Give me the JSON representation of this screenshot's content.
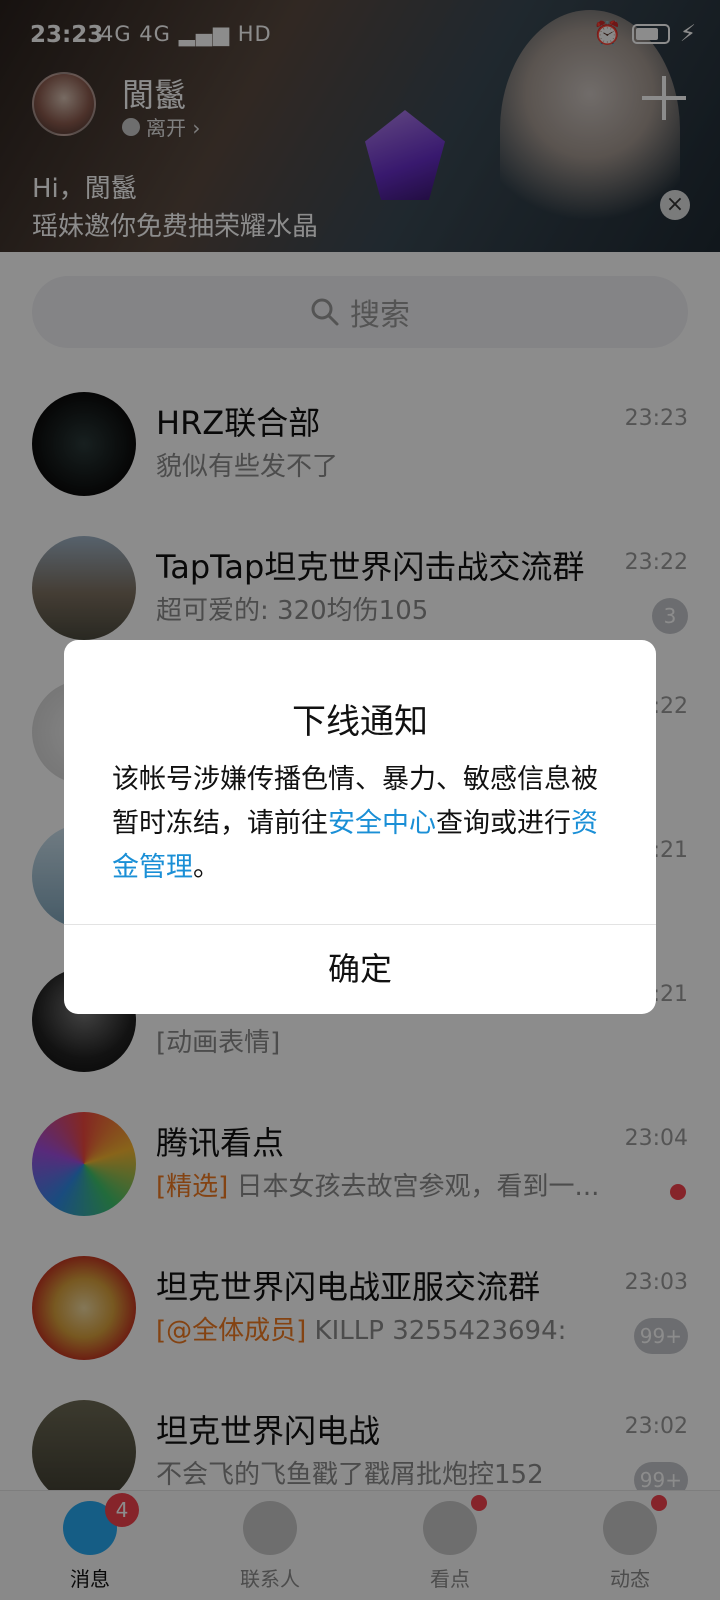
{
  "status_bar": {
    "time": "23:23",
    "signal": "4G 4G",
    "hd": "HD"
  },
  "header": {
    "nickname": "閬鬣",
    "presence": "离开 ›",
    "promo_greeting": "Hi，閬鬣",
    "promo_text": "瑶妹邀你免费抽荣耀水晶"
  },
  "search": {
    "placeholder": "搜索"
  },
  "chats": [
    {
      "name": "HRZ联合部",
      "message": "貌似有些发不了",
      "time": "23:23",
      "badge": ""
    },
    {
      "name": "TapTap坦克世界闪击战交流群",
      "message": "超可爱的: 320均伤105",
      "time": "23:22",
      "badge": "3"
    },
    {
      "name": "",
      "message": "",
      "time": ":22",
      "badge": ""
    },
    {
      "name": "",
      "message": "",
      "time": ":21",
      "badge": ""
    },
    {
      "name": "",
      "message": "[动画表情]",
      "time": ":21",
      "badge": ""
    },
    {
      "name": "腾讯看点",
      "tag": "[精选]",
      "message": " 日本女孩去故宫参观，看到一...",
      "time": "23:04",
      "badge": ""
    },
    {
      "name": "坦克世界闪电战亚服交流群",
      "tag": "[@全体成员]",
      "message": " KILLP 3255423694:",
      "time": "23:03",
      "badge": "99+"
    },
    {
      "name": "坦克世界闪电战",
      "message": "不会飞的飞鱼戳了戳屑批炮控152",
      "time": "23:02",
      "badge": "99+"
    }
  ],
  "tabs": [
    {
      "label": "消息",
      "badge": "4",
      "icon": "chat-bubble-icon"
    },
    {
      "label": "联系人",
      "icon": "contacts-icon"
    },
    {
      "label": "看点",
      "icon": "eye-icon"
    },
    {
      "label": "动态",
      "icon": "planet-icon"
    }
  ],
  "dialog": {
    "title": "下线通知",
    "body_1": "该帐号涉嫌传播色情、暴力、敏感信息被暂时冻结，请前往",
    "link_1": "安全中心",
    "body_2": "查询或进行",
    "link_2": "资金管理",
    "body_3": "。",
    "confirm": "确定"
  },
  "colors": {
    "link": "#1a8fd6",
    "badge_red": "#f5424d",
    "tag_orange": "#f07a22"
  }
}
